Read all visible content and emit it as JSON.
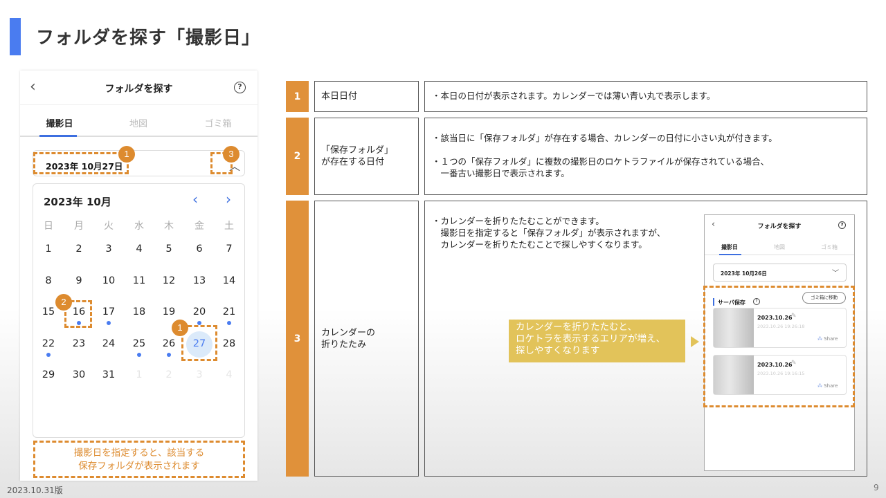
{
  "page": {
    "title": "フォルダを探す「撮影日」",
    "version": "2023.10.31版",
    "page_number": "9"
  },
  "phone": {
    "back_icon": "‹",
    "title": "フォルダを探す",
    "help_icon": "?",
    "tabs": [
      "撮影日",
      "地図",
      "ゴミ箱"
    ],
    "date_value": "2023年 10月27日",
    "caret_icon": "^",
    "calendar": {
      "title": "2023年 10月",
      "prev_icon": "‹",
      "next_icon": "›",
      "weekdays": [
        "日",
        "月",
        "火",
        "水",
        "木",
        "金",
        "土"
      ],
      "rows": [
        [
          "1",
          "2",
          "3",
          "4",
          "5",
          "6",
          "7"
        ],
        [
          "8",
          "9",
          "10",
          "11",
          "12",
          "13",
          "14"
        ],
        [
          "15",
          "16",
          "17",
          "18",
          "19",
          "20",
          "21"
        ],
        [
          "22",
          "23",
          "24",
          "25",
          "26",
          "27",
          "28"
        ],
        [
          "29",
          "30",
          "31",
          "1",
          "2",
          "3",
          "4"
        ]
      ],
      "today": "27",
      "days_with_folder": [
        "16",
        "17",
        "20",
        "21",
        "22",
        "25",
        "26"
      ]
    },
    "badges": [
      "1",
      "2",
      "3"
    ],
    "note_line1": "撮影日を指定すると、該当する",
    "note_line2": "保存フォルダが表示されます"
  },
  "table": {
    "rows": [
      {
        "num": "1",
        "label": "本日日付",
        "desc": [
          "・本日の日付が表示されます。カレンダーでは薄い青い丸で表示します。"
        ]
      },
      {
        "num": "2",
        "label_lines": [
          "「保存フォルダ」",
          "が存在する日付"
        ],
        "desc": [
          "・該当日に「保存フォルダ」が存在する場合、カレンダーの日付に小さい丸が付きます。",
          "",
          "・１つの「保存フォルダ」に複数の撮影日のロケトラファイルが保存されている場合、",
          "　一番古い撮影日で表示されます。"
        ]
      },
      {
        "num": "3",
        "label_lines": [
          "カレンダーの",
          "折りたたみ"
        ],
        "desc": [
          "・カレンダーを折りたたむことができます。",
          "　撮影日を指定すると「保存フォルダ」が表示されますが、",
          "　カレンダーを折りたたむことで探しやすくなります。"
        ]
      }
    ]
  },
  "mini": {
    "title": "フォルダを探す",
    "tabs": [
      "撮影日",
      "地図",
      "ゴミ箱"
    ],
    "date_value": "2023年 10月26日",
    "section_title": "サーバ保存",
    "move_button": "ゴミ箱に移動",
    "cards": [
      {
        "date": "2023.10.26",
        "time": "2023.10.26 19:26:18",
        "share": "Share"
      },
      {
        "date": "2023.10.26",
        "time": "2023.10.26 19:16:15",
        "share": "Share"
      }
    ]
  },
  "callout": {
    "lines": [
      "カレンダーを折りたたむと、",
      "ロケトラを表示するエリアが増え、",
      "探しやすくなります"
    ]
  },
  "colors": {
    "accent_blue": "#4a7cf0",
    "orange": "#dd8b2f",
    "num_orange": "#e0913a",
    "callout_yellow": "#e2c35a"
  }
}
